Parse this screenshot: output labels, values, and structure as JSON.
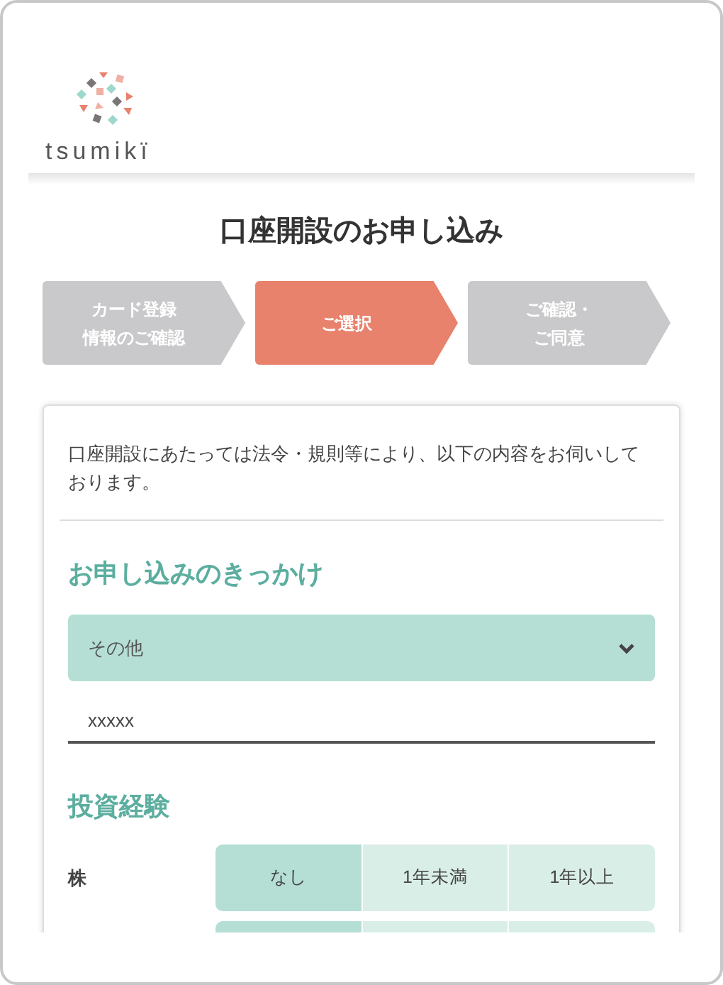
{
  "logo": {
    "text": "tsumikï"
  },
  "title": "口座開設のお申し込み",
  "steps": [
    {
      "lines": [
        "カード登録",
        "情報のご確認"
      ],
      "selected": false
    },
    {
      "lines": [
        "ご選択"
      ],
      "selected": true
    },
    {
      "lines": [
        "ご確認・",
        "ご同意"
      ],
      "selected": false
    }
  ],
  "intro": "口座開設にあたっては法令・規則等により、以下の内容をお伺いしております。",
  "trigger_section": {
    "heading": "お申し込みのきっかけ",
    "select": {
      "value": "その他"
    },
    "input": {
      "value": "xxxxx"
    }
  },
  "experience_section": {
    "heading": "投資経験",
    "rows": [
      {
        "label": "株",
        "options": [
          {
            "label": "なし",
            "selected": true
          },
          {
            "label": "1年未満",
            "selected": false
          },
          {
            "label": "1年以上",
            "selected": false
          }
        ]
      },
      {
        "options": [
          {
            "selected": true
          },
          {
            "selected": false
          },
          {
            "selected": false
          }
        ]
      }
    ]
  }
}
